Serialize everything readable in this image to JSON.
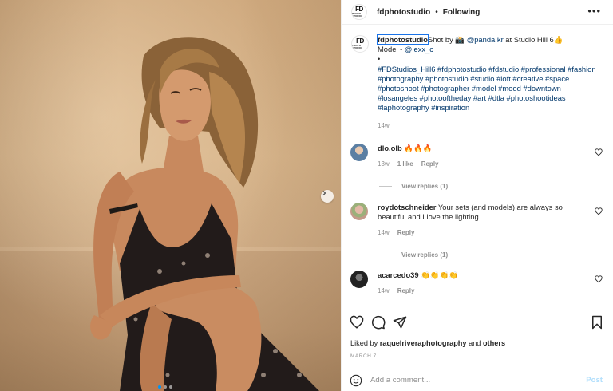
{
  "post": {
    "avatar_logo_text": "FD",
    "avatar_logo_sub": "PHOTO STUDIO",
    "username": "fdphotostudio",
    "separator": "•",
    "follow_state": "Following",
    "more_icon": "more-horizontal-icon"
  },
  "caption": {
    "username": "fdphotostudio",
    "line1_a": "Shot by 📸 ",
    "line1_mention": "@panda.kr",
    "line1_b": " at Studio Hill 6👍",
    "line2_a": "Model - ",
    "line2_mention": "@lexx_c",
    "bullet": "•",
    "hashtags": "#FDStudios_Hill6 #fdphotostudio #fdstudio #professional #fashion #photography #photostudio #studio #loft #creative #space #photoshoot #photographer #model #mood #downtown #losangeles #photooftheday #art #dtla #photoshootideas #laphotography #inspiration",
    "time": "14w"
  },
  "comments": [
    {
      "username": "dlo.olb",
      "text": "🔥🔥🔥",
      "time": "13w",
      "likes": "1 like",
      "reply_label": "Reply",
      "view_replies": "View replies (1)",
      "avatar_color": "#5b7fa3"
    },
    {
      "username": "roydotschneider",
      "text": "Your sets (and models) are always so beautiful and I love the lighting",
      "time": "14w",
      "reply_label": "Reply",
      "view_replies": "View replies (1)",
      "avatar_color": "#c49a8a"
    },
    {
      "username": "acarcedo39",
      "text": "👏👏👏👏",
      "time": "14w",
      "reply_label": "Reply",
      "avatar_color": "#222222"
    }
  ],
  "actions": {
    "icons": [
      "heart-icon",
      "comment-icon",
      "share-icon",
      "bookmark-icon"
    ]
  },
  "likes": {
    "prefix": "Liked by ",
    "user": "raquelriveraphotography",
    "middle": " and ",
    "others": "others"
  },
  "date": "MARCH 7",
  "composer": {
    "placeholder": "Add a comment...",
    "post_label": "Post"
  },
  "carousel": {
    "total_slides": 3,
    "active_slide": 1
  },
  "colors": {
    "link_blue": "#00376b",
    "accent": "#0095f6",
    "post_disabled": "#b2dffc",
    "muted": "#8e8e8e"
  }
}
